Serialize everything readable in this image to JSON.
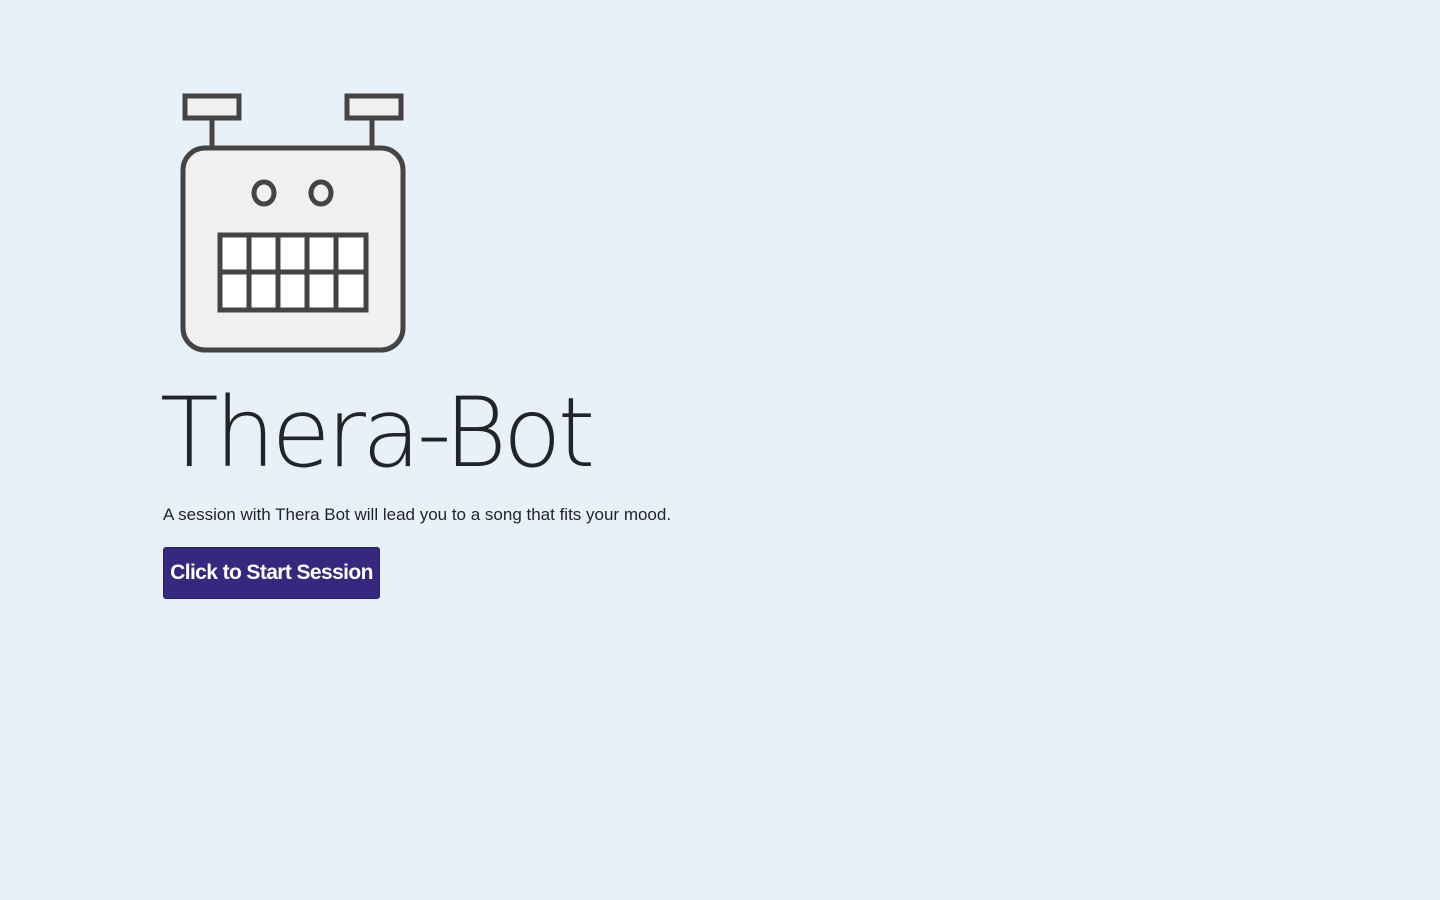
{
  "logo": {
    "icon": "robot-icon",
    "stroke_color": "#444444",
    "fill_color": "#f0f0f0"
  },
  "hero": {
    "title": "Thera-Bot",
    "tagline": "A session with Thera Bot will lead you to a song that fits your mood.",
    "start_button_label": "Click to Start Session"
  },
  "colors": {
    "background": "#e9f1f8",
    "button": "#36277f",
    "text": "#212529"
  }
}
